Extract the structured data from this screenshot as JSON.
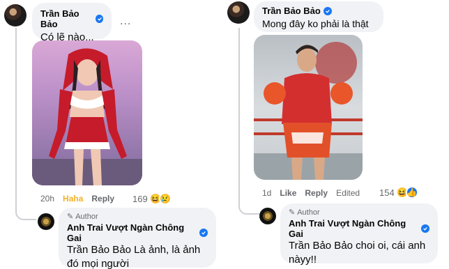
{
  "left": {
    "comment": {
      "author": "Trần Bảo Bảo",
      "text": "Có lẽ nào...",
      "more": "...",
      "meta": {
        "time": "20h",
        "reaction": "Haha",
        "reply": "Reply",
        "count": "169"
      }
    },
    "reply": {
      "badge": "Author",
      "author": "Anh Trai Vượt Ngàn Chông Gai",
      "mention": "Trần Bảo Bảo",
      "text_line1": "Là ảnh, là ảnh",
      "text_line2": "đó mọi người"
    }
  },
  "right": {
    "comment": {
      "author": "Trần Bảo Bảo",
      "text": "Mong đây ko phải là thật",
      "meta": {
        "time": "1d",
        "like": "Like",
        "reply": "Reply",
        "edited": "Edited",
        "count": "154"
      }
    },
    "reply": {
      "badge": "Author",
      "author": "Anh Trai Vượt Ngàn Chông Gai",
      "mention": "Trần Bảo Bảo",
      "text_line1": "choi oi, cái anh",
      "text_line2": "nàyy!!"
    }
  },
  "colors": {
    "bubble": "#f0f2f5",
    "verified": "#1877f2",
    "haha": "#f7b125",
    "meta": "#65676b"
  }
}
